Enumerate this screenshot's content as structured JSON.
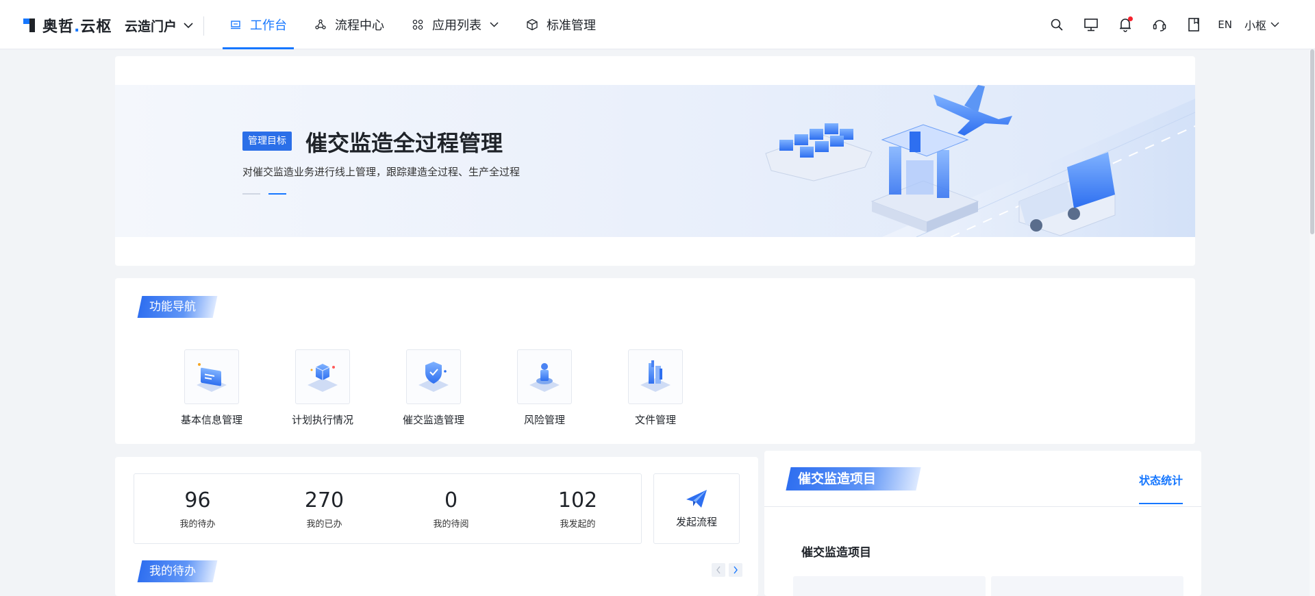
{
  "brand": {
    "name_a": "奥哲",
    "dot": ".",
    "name_b": "云枢"
  },
  "portal": {
    "label": "云造门户"
  },
  "nav": [
    {
      "label": "工作台",
      "icon": "monitor-icon",
      "active": true
    },
    {
      "label": "流程中心",
      "icon": "flow-icon"
    },
    {
      "label": "应用列表",
      "icon": "apps-icon",
      "dropdown": true
    },
    {
      "label": "标准管理",
      "icon": "cube-icon"
    }
  ],
  "toolbar": {
    "lang": "EN",
    "user": "小枢",
    "notification_dot_color": "#f5222d"
  },
  "banner": {
    "tag": "管理目标",
    "title": "催交监造全过程管理",
    "desc": "对催交监造业务进行线上管理，跟踪建造全过程、生产全过程"
  },
  "func_nav": {
    "title": "功能导航",
    "items": [
      {
        "label": "基本信息管理",
        "icon": "info-screen-icon"
      },
      {
        "label": "计划执行情况",
        "icon": "plan-cube-icon"
      },
      {
        "label": "催交监造管理",
        "icon": "shield-icon"
      },
      {
        "label": "风险管理",
        "icon": "risk-figure-icon"
      },
      {
        "label": "文件管理",
        "icon": "file-icon"
      }
    ]
  },
  "stats": [
    {
      "value": "96",
      "label": "我的待办"
    },
    {
      "value": "270",
      "label": "我的已办"
    },
    {
      "value": "0",
      "label": "我的待阅"
    },
    {
      "value": "102",
      "label": "我发起的"
    }
  ],
  "launch": {
    "label": "发起流程"
  },
  "todo": {
    "title": "我的待办"
  },
  "project": {
    "title": "催交监造项目",
    "tab": "状态统计",
    "subtitle": "催交监造项目"
  },
  "colors": {
    "accent": "#1677ff",
    "tag": "#2b6fe8"
  }
}
